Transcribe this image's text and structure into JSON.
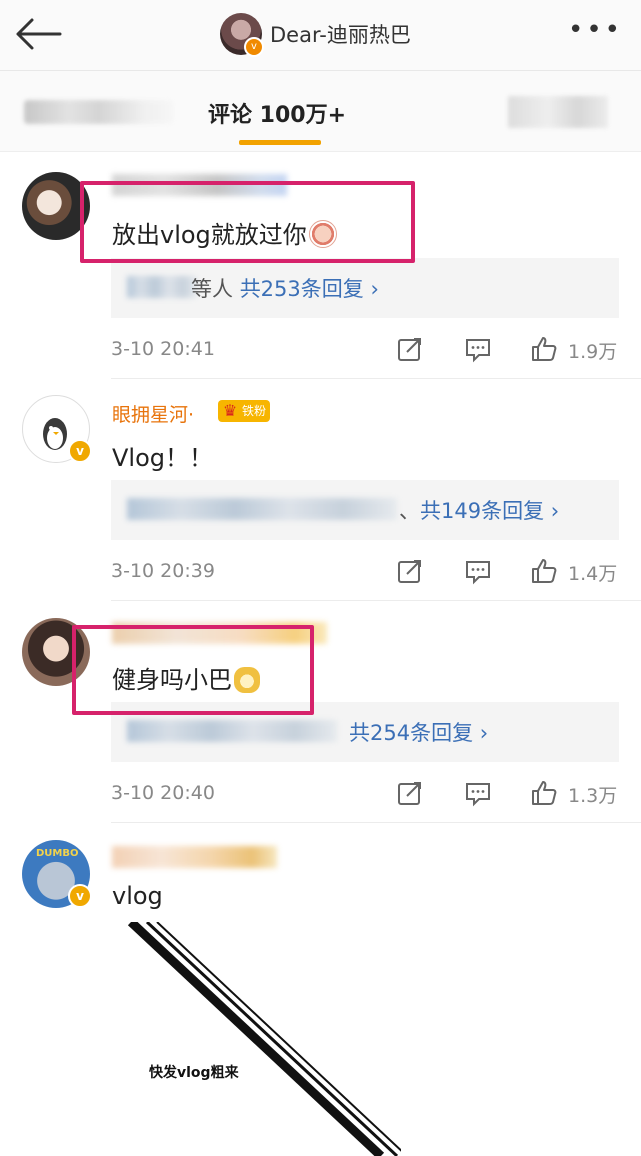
{
  "header": {
    "title": "Dear-迪丽热巴"
  },
  "tabs": {
    "active_label": "评论 100万+"
  },
  "comments": [
    {
      "text": "放出vlog就放过你",
      "reply_prefix": "等人",
      "reply_link": "共253条回复 ›",
      "time": "3-10 20:41",
      "likes": "1.9万"
    },
    {
      "username": "眼拥星河·",
      "fan_badge": "铁粉",
      "text": "Vlog！！",
      "reply_prefix": "、",
      "reply_link": "共149条回复 ›",
      "time": "3-10 20:39",
      "likes": "1.4万"
    },
    {
      "text": "健身吗小巴",
      "reply_prefix": "",
      "reply_link": "共254条回复 ›",
      "time": "3-10 20:40",
      "likes": "1.3万"
    },
    {
      "text": "vlog",
      "image_caption": "快发vlog粗来",
      "avatar_label": "DUMBO"
    }
  ],
  "colors": {
    "accent": "#f2a200",
    "link": "#3b6fb6",
    "username": "#e8740c",
    "highlight": "#d6226b"
  },
  "icons": [
    "back-arrow-icon",
    "more-dots-icon",
    "verified-icon",
    "crown-icon",
    "repost-icon",
    "comment-icon",
    "like-icon",
    "emoji-icon"
  ]
}
